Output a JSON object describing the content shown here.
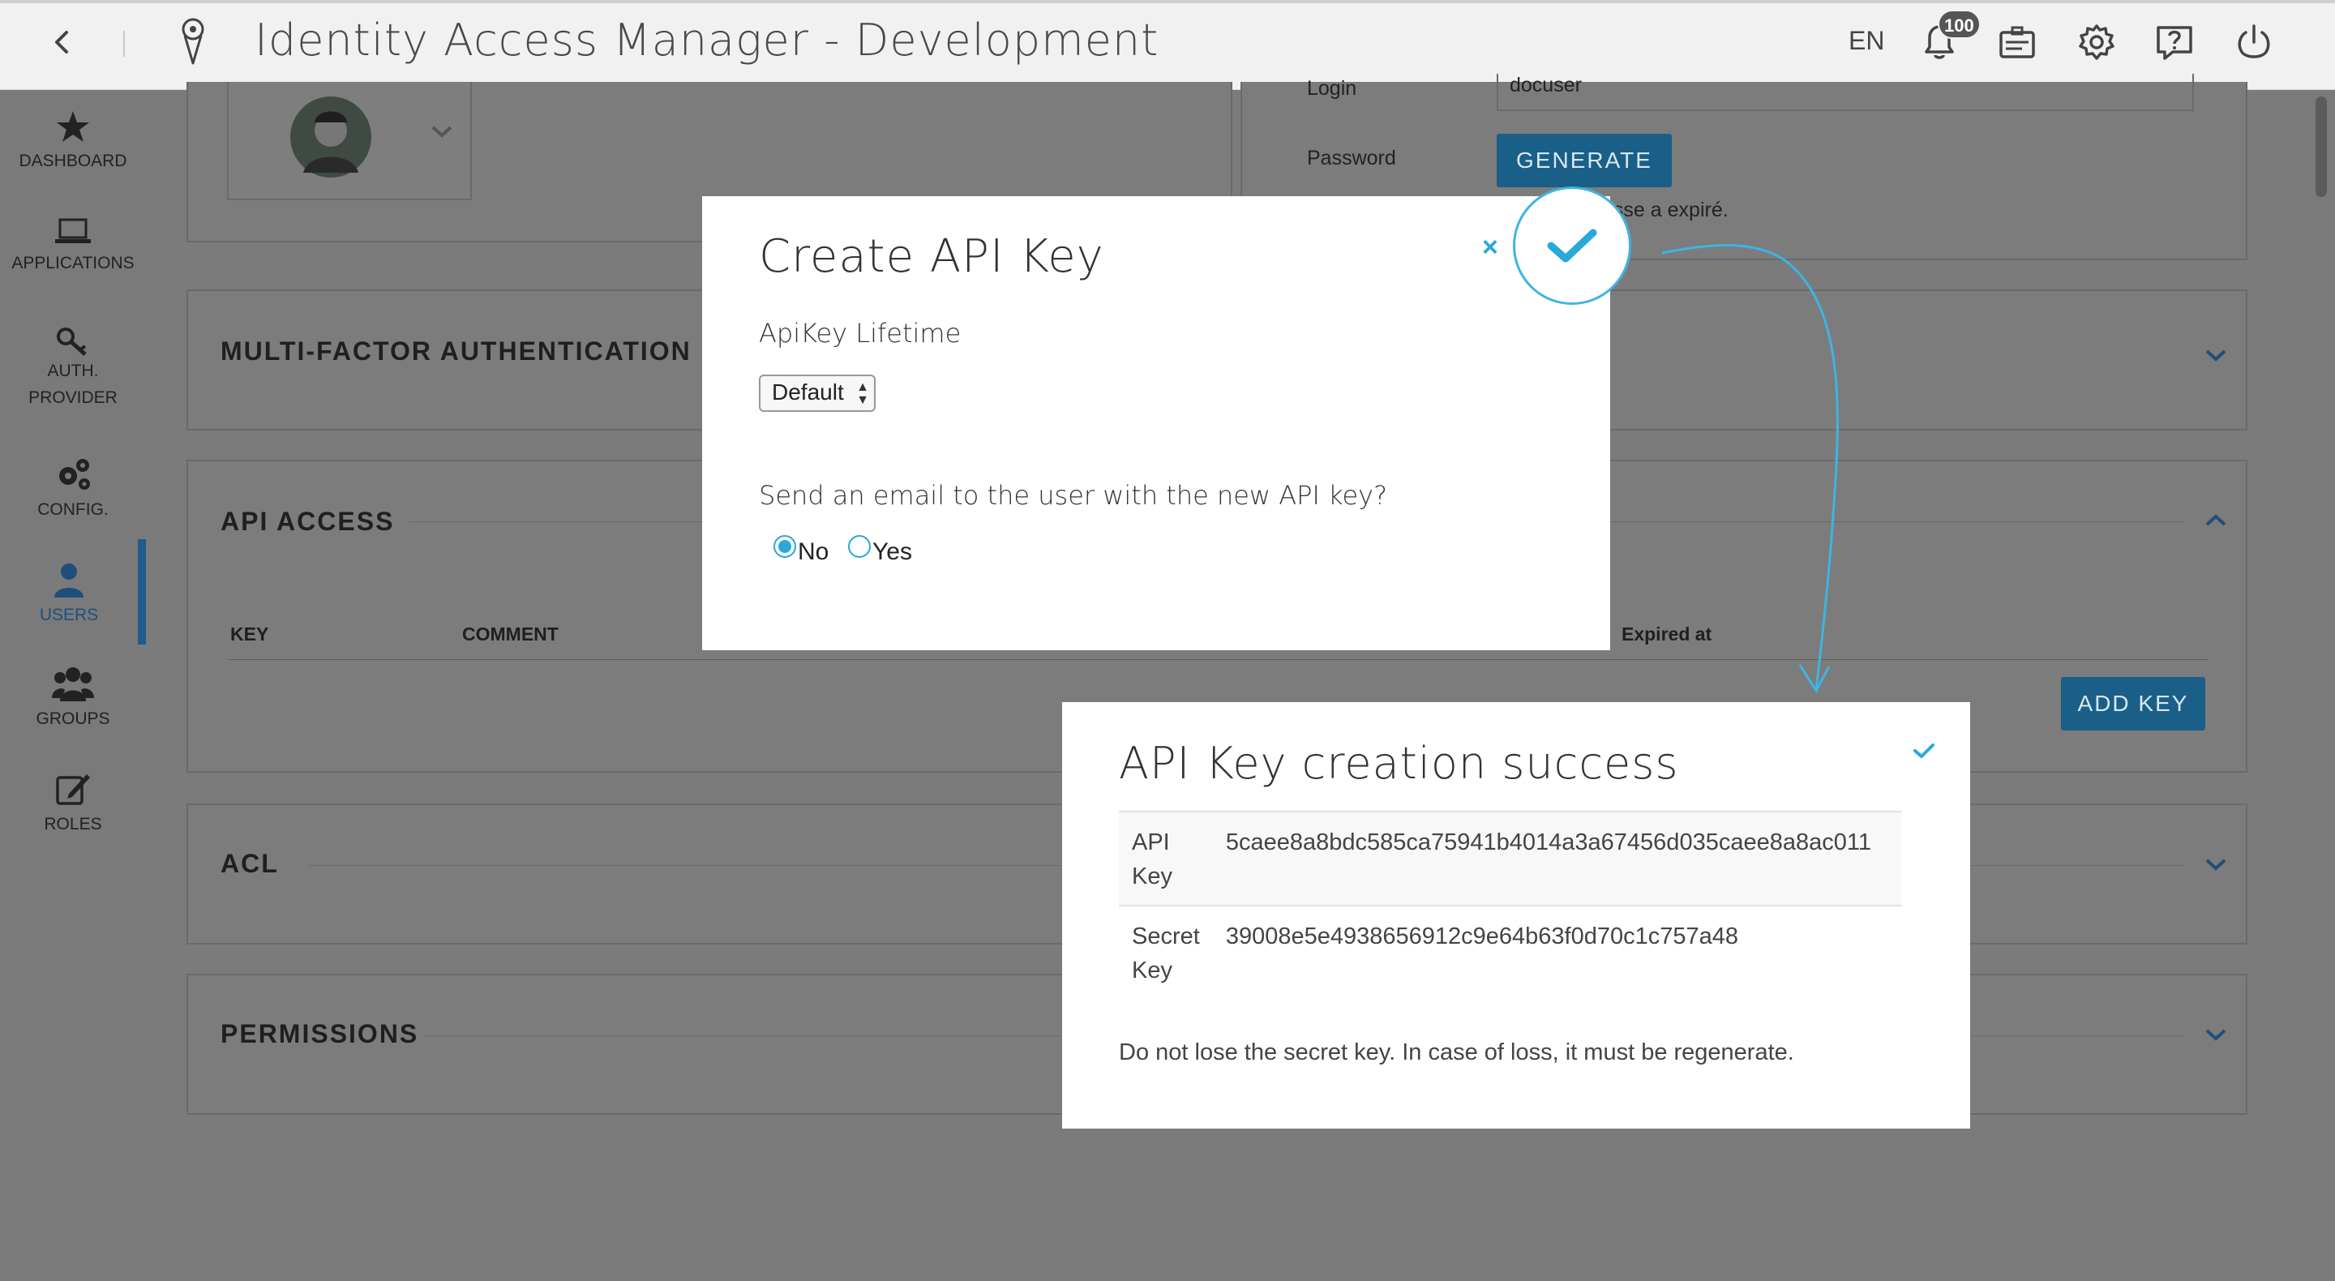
{
  "app": {
    "title": "Identity Access Manager - Development",
    "lang": "EN",
    "notification_count": "100",
    "icons": [
      "back-arrow-icon",
      "logo-icon",
      "bell-icon",
      "id-card-icon",
      "gear-icon",
      "help-icon",
      "power-icon"
    ]
  },
  "sidebar": {
    "items": [
      {
        "label": "DASHBOARD",
        "icon": "star-icon"
      },
      {
        "label": "APPLICATIONS",
        "icon": "laptop-icon"
      },
      {
        "label": "AUTH.",
        "label2": "PROVIDER",
        "icon": "key-icon"
      },
      {
        "label": "CONFIG.",
        "icon": "gears-icon"
      },
      {
        "label": "USERS",
        "icon": "user-icon",
        "active": true
      },
      {
        "label": "GROUPS",
        "icon": "group-icon"
      },
      {
        "label": "ROLES",
        "icon": "edit-icon"
      }
    ]
  },
  "main": {
    "login_label": "Login",
    "login_value": "docuser",
    "password_label": "Password",
    "generate_label": "GENERATE",
    "password_note": "Le mot de passe a expiré.",
    "sections": {
      "mfa": "MULTI-FACTOR AUTHENTICATION",
      "api": "API ACCESS",
      "acl": "ACL",
      "permissions": "PERMISSIONS"
    },
    "api_table": {
      "headers": [
        "KEY",
        "COMMENT",
        "Expired at"
      ]
    },
    "add_key_label": "ADD KEY"
  },
  "create_modal": {
    "title": "Create API Key",
    "lifetime_label": "ApiKey Lifetime",
    "lifetime_value": "Default",
    "email_question": "Send an email to the user with the new API key?",
    "radio_no": "No",
    "radio_yes": "Yes",
    "selected": "No",
    "close_symbol": "×"
  },
  "success_modal": {
    "title": "API Key creation success",
    "rows": [
      {
        "key_line1": "API",
        "key_line2": "Key",
        "value": "5caee8a8bdc585ca75941b4014a3a67456d035caee8a8ac011"
      },
      {
        "key_line1": "Secret",
        "key_line2": "Key",
        "value": "39008e5e4938656912c9e64b63f0d70c1c757a48"
      }
    ],
    "note": "Do not lose the secret key. In case of loss, it must be regenerate."
  },
  "colors": {
    "accent": "#29a8db",
    "button_dimmed": "#1a5f87",
    "overlay_gray": "#7a7a7a"
  }
}
